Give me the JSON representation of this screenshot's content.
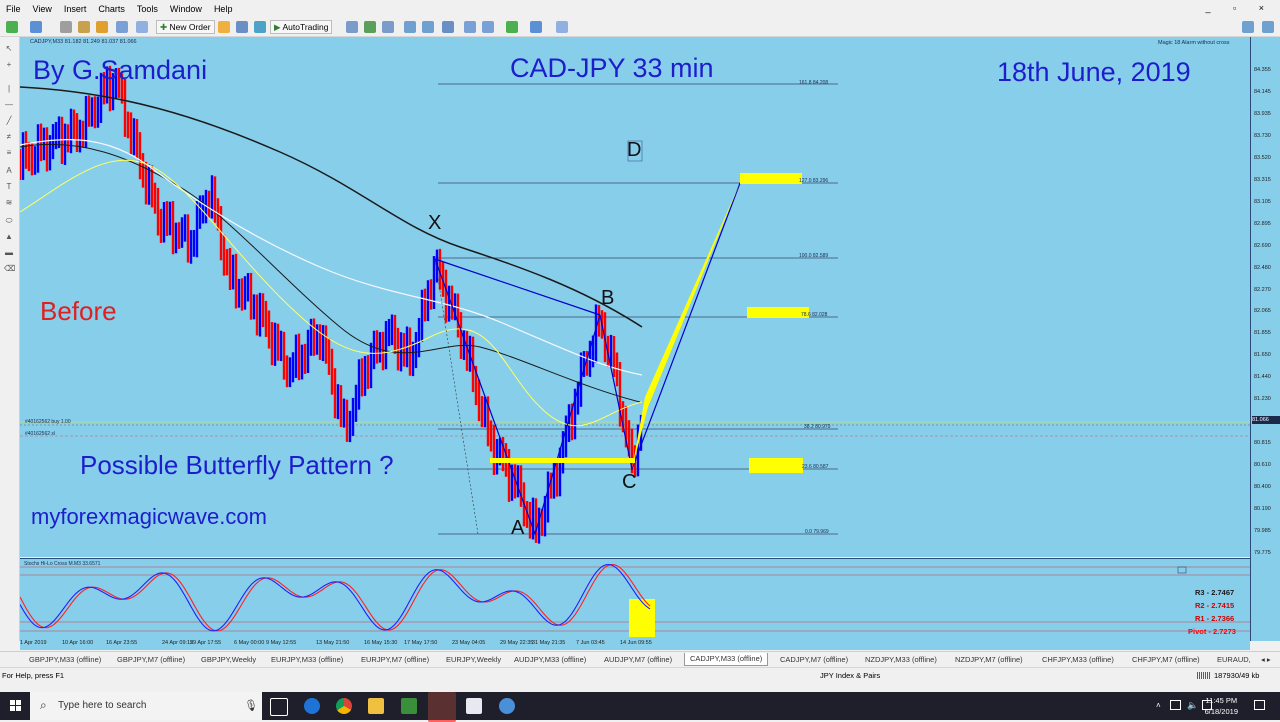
{
  "menu": {
    "items": [
      "File",
      "View",
      "Insert",
      "Charts",
      "Tools",
      "Window",
      "Help"
    ]
  },
  "toolbar": {
    "new_order_label": "New Order",
    "autotrading_label": "AutoTrading"
  },
  "chart": {
    "symbol_header": "CADJPY,M33  81.182 81.249 81.037 81.066",
    "indicator_header": "Magic 18 Alarm without cross",
    "title": "CAD-JPY 33 min",
    "author": "By G.Samdani",
    "date": "18th June, 2019",
    "before_label": "Before",
    "pattern_label": "Possible Butterfly Pattern ?",
    "website": "myforexmagicwave.com",
    "point_labels": {
      "x": "X",
      "a": "A",
      "b": "B",
      "c": "C",
      "d": "D"
    },
    "order_line_1": "#40162562 buy 1.00",
    "order_line_2": "#40162562 sl",
    "fib_levels": [
      {
        "label": "161.8  84.208"
      },
      {
        "label": "127.0  83.296"
      },
      {
        "label": "100.0  82.589"
      },
      {
        "label": "78.6  82.028"
      },
      {
        "label": "38.2  80.970"
      },
      {
        "label": "23.6  80.587"
      },
      {
        "label": "0.0  79.969"
      }
    ],
    "y_ticks": [
      "84.355",
      "84.145",
      "83.935",
      "83.730",
      "83.520",
      "83.315",
      "83.105",
      "82.895",
      "82.690",
      "82.480",
      "82.270",
      "82.065",
      "81.855",
      "81.650",
      "81.440",
      "81.230",
      "81.066",
      "80.815",
      "80.610",
      "80.400",
      "80.190",
      "79.985",
      "79.775"
    ],
    "price_label": "81.066"
  },
  "subwindow": {
    "indicator_label": "Stochs Hi-Lo Cross M.M3 33.6571",
    "pivots": {
      "r3": "R3 - 2.7467",
      "r2": "R2 - 2.7415",
      "r1": "R1 - 2.7366",
      "pivot": "Pivot - 2.7273"
    },
    "colors": {
      "r3": "#1a1a1a",
      "r2": "#cc0000",
      "r1": "#cc0000",
      "pivot": "#ff0000"
    }
  },
  "dates": [
    "1 Apr 2019",
    "10 Apr 16:00",
    "16 Apr 23:55",
    "24 Apr 09:15",
    "29 Apr 17:55",
    "6 May 00:00",
    "9 May 12:55",
    "13 May 21:50",
    "16 May 15:30",
    "17 May 17:50",
    "23 May 04:05",
    "29 May 22:35",
    "31 May 21:35",
    "7 Jun 03:45",
    "14 Jun 09:55"
  ],
  "tabs": [
    "GBPJPY,M33 (offline)",
    "GBPJPY,M7 (offline)",
    "GBPJPY,Weekly",
    "EURJPY,M33 (offline)",
    "EURJPY,M7 (offline)",
    "EURJPY,Weekly",
    "AUDJPY,M33 (offline)",
    "AUDJPY,M7 (offline)",
    "CADJPY,M33 (offline)",
    "CADJPY,M7 (offline)",
    "NZDJPY,M33 (offline)",
    "NZDJPY,M7 (offline)",
    "CHFJPY,M33 (offline)",
    "CHFJPY,M7 (offline)",
    "EURAUD,"
  ],
  "active_tab_index": 8,
  "status": {
    "help_text": "For Help, press F1",
    "profile": "JPY Index & Pairs",
    "traffic": "187930/49 kb"
  },
  "taskbar": {
    "search_placeholder": "Type here to search",
    "time": "11:45 PM",
    "date": "6/18/2019"
  },
  "colors": {
    "chart_bg": "#87ceeb",
    "bull": "#0000ff",
    "bear": "#ff0000",
    "highlight": "#ffff00"
  }
}
